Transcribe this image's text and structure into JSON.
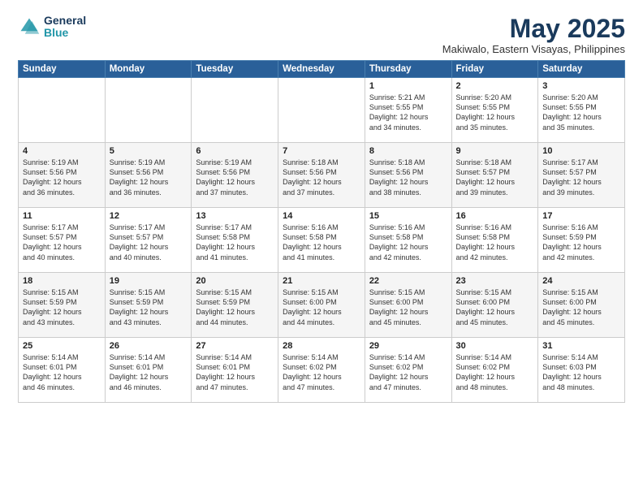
{
  "logo": {
    "line1": "General",
    "line2": "Blue"
  },
  "title": "May 2025",
  "location": "Makiwalo, Eastern Visayas, Philippines",
  "header_days": [
    "Sunday",
    "Monday",
    "Tuesday",
    "Wednesday",
    "Thursday",
    "Friday",
    "Saturday"
  ],
  "weeks": [
    [
      {
        "day": "",
        "info": ""
      },
      {
        "day": "",
        "info": ""
      },
      {
        "day": "",
        "info": ""
      },
      {
        "day": "",
        "info": ""
      },
      {
        "day": "1",
        "info": "Sunrise: 5:21 AM\nSunset: 5:55 PM\nDaylight: 12 hours\nand 34 minutes."
      },
      {
        "day": "2",
        "info": "Sunrise: 5:20 AM\nSunset: 5:55 PM\nDaylight: 12 hours\nand 35 minutes."
      },
      {
        "day": "3",
        "info": "Sunrise: 5:20 AM\nSunset: 5:55 PM\nDaylight: 12 hours\nand 35 minutes."
      }
    ],
    [
      {
        "day": "4",
        "info": "Sunrise: 5:19 AM\nSunset: 5:56 PM\nDaylight: 12 hours\nand 36 minutes."
      },
      {
        "day": "5",
        "info": "Sunrise: 5:19 AM\nSunset: 5:56 PM\nDaylight: 12 hours\nand 36 minutes."
      },
      {
        "day": "6",
        "info": "Sunrise: 5:19 AM\nSunset: 5:56 PM\nDaylight: 12 hours\nand 37 minutes."
      },
      {
        "day": "7",
        "info": "Sunrise: 5:18 AM\nSunset: 5:56 PM\nDaylight: 12 hours\nand 37 minutes."
      },
      {
        "day": "8",
        "info": "Sunrise: 5:18 AM\nSunset: 5:56 PM\nDaylight: 12 hours\nand 38 minutes."
      },
      {
        "day": "9",
        "info": "Sunrise: 5:18 AM\nSunset: 5:57 PM\nDaylight: 12 hours\nand 39 minutes."
      },
      {
        "day": "10",
        "info": "Sunrise: 5:17 AM\nSunset: 5:57 PM\nDaylight: 12 hours\nand 39 minutes."
      }
    ],
    [
      {
        "day": "11",
        "info": "Sunrise: 5:17 AM\nSunset: 5:57 PM\nDaylight: 12 hours\nand 40 minutes."
      },
      {
        "day": "12",
        "info": "Sunrise: 5:17 AM\nSunset: 5:57 PM\nDaylight: 12 hours\nand 40 minutes."
      },
      {
        "day": "13",
        "info": "Sunrise: 5:17 AM\nSunset: 5:58 PM\nDaylight: 12 hours\nand 41 minutes."
      },
      {
        "day": "14",
        "info": "Sunrise: 5:16 AM\nSunset: 5:58 PM\nDaylight: 12 hours\nand 41 minutes."
      },
      {
        "day": "15",
        "info": "Sunrise: 5:16 AM\nSunset: 5:58 PM\nDaylight: 12 hours\nand 42 minutes."
      },
      {
        "day": "16",
        "info": "Sunrise: 5:16 AM\nSunset: 5:58 PM\nDaylight: 12 hours\nand 42 minutes."
      },
      {
        "day": "17",
        "info": "Sunrise: 5:16 AM\nSunset: 5:59 PM\nDaylight: 12 hours\nand 42 minutes."
      }
    ],
    [
      {
        "day": "18",
        "info": "Sunrise: 5:15 AM\nSunset: 5:59 PM\nDaylight: 12 hours\nand 43 minutes."
      },
      {
        "day": "19",
        "info": "Sunrise: 5:15 AM\nSunset: 5:59 PM\nDaylight: 12 hours\nand 43 minutes."
      },
      {
        "day": "20",
        "info": "Sunrise: 5:15 AM\nSunset: 5:59 PM\nDaylight: 12 hours\nand 44 minutes."
      },
      {
        "day": "21",
        "info": "Sunrise: 5:15 AM\nSunset: 6:00 PM\nDaylight: 12 hours\nand 44 minutes."
      },
      {
        "day": "22",
        "info": "Sunrise: 5:15 AM\nSunset: 6:00 PM\nDaylight: 12 hours\nand 45 minutes."
      },
      {
        "day": "23",
        "info": "Sunrise: 5:15 AM\nSunset: 6:00 PM\nDaylight: 12 hours\nand 45 minutes."
      },
      {
        "day": "24",
        "info": "Sunrise: 5:15 AM\nSunset: 6:00 PM\nDaylight: 12 hours\nand 45 minutes."
      }
    ],
    [
      {
        "day": "25",
        "info": "Sunrise: 5:14 AM\nSunset: 6:01 PM\nDaylight: 12 hours\nand 46 minutes."
      },
      {
        "day": "26",
        "info": "Sunrise: 5:14 AM\nSunset: 6:01 PM\nDaylight: 12 hours\nand 46 minutes."
      },
      {
        "day": "27",
        "info": "Sunrise: 5:14 AM\nSunset: 6:01 PM\nDaylight: 12 hours\nand 47 minutes."
      },
      {
        "day": "28",
        "info": "Sunrise: 5:14 AM\nSunset: 6:02 PM\nDaylight: 12 hours\nand 47 minutes."
      },
      {
        "day": "29",
        "info": "Sunrise: 5:14 AM\nSunset: 6:02 PM\nDaylight: 12 hours\nand 47 minutes."
      },
      {
        "day": "30",
        "info": "Sunrise: 5:14 AM\nSunset: 6:02 PM\nDaylight: 12 hours\nand 48 minutes."
      },
      {
        "day": "31",
        "info": "Sunrise: 5:14 AM\nSunset: 6:03 PM\nDaylight: 12 hours\nand 48 minutes."
      }
    ]
  ]
}
